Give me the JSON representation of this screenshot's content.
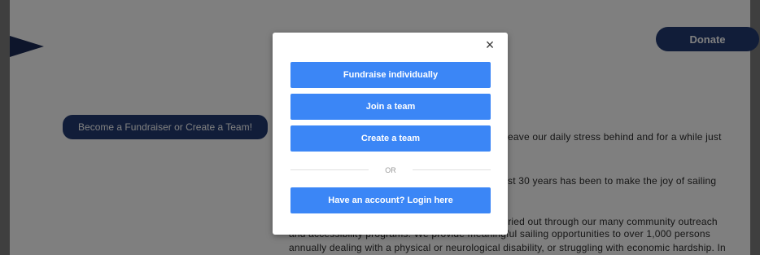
{
  "header": {
    "donate_label": "Donate"
  },
  "hero": {
    "fundraiser_label": "Become a Fundraiser or Create a Team!"
  },
  "body_lines": [
    "eave our daily stress behind and for a while just",
    "st 30 years has been to make the joy of sailing",
    "rried out through our many community outreach",
    "and accessibility programs. We provide meaningful sailing opportunities to over 1,000 persons",
    "annually dealing with a physical or neurological disability, or struggling with economic hardship. In"
  ],
  "modal": {
    "close_glyph": "×",
    "buttons": [
      {
        "label": "Fundraise individually"
      },
      {
        "label": "Join a team"
      },
      {
        "label": "Create a team"
      }
    ],
    "or_label": "OR",
    "login_label": "Have an account? Login here"
  },
  "colors": {
    "primary_blue": "#3b86f6",
    "navy": "#223a73",
    "overlay": "rgba(0,0,0,0.5)"
  }
}
